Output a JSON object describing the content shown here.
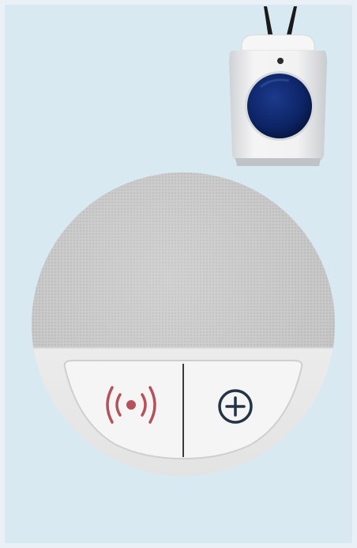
{
  "scene": {
    "background_color": "#d9e9f2",
    "frame_color": "#e9f1f6"
  },
  "pendant": {
    "body_color": "#ececec",
    "button_color": "#0d2465",
    "lanyard_color": "#1a1a1a"
  },
  "hub": {
    "speaker_mesh_color": "#c7c7c7",
    "base_color": "#f1f1f1",
    "left_button_icon": "alarm-signal-icon",
    "left_button_icon_color": "#b6505a",
    "right_button_icon": "plus-circle-icon",
    "right_button_icon_color": "#243446"
  }
}
